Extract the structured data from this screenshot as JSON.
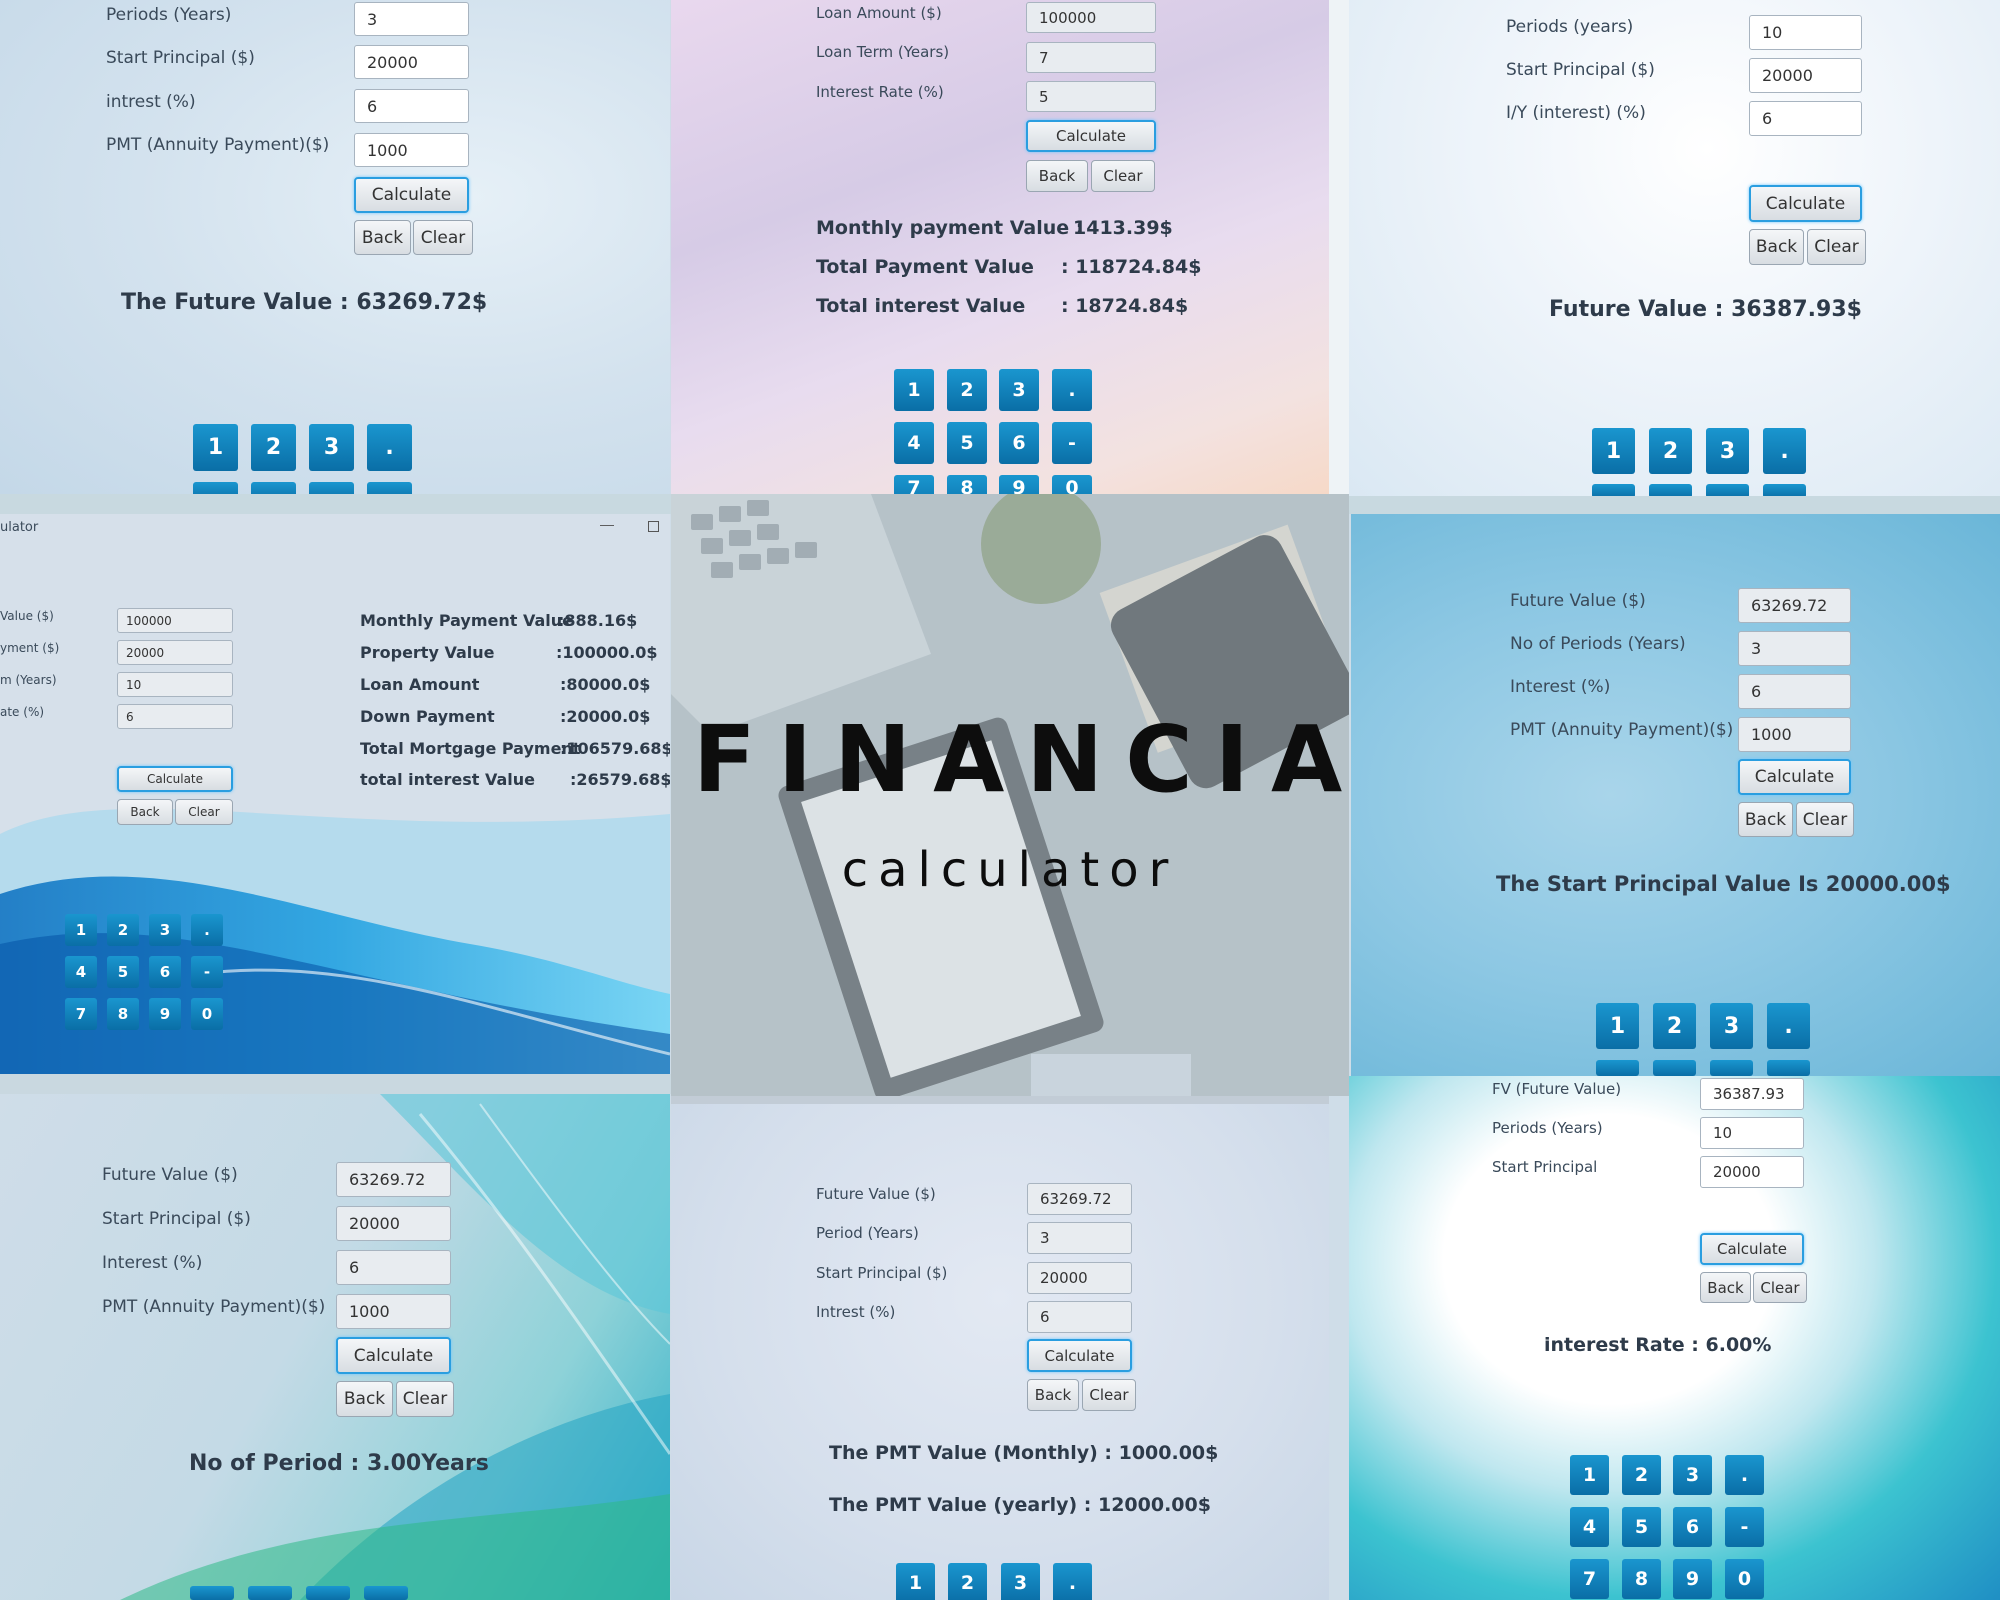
{
  "p1": {
    "labels": [
      "Periods (Years)",
      "Start Principal ($)",
      "intrest (%)",
      "PMT (Annuity Payment)($)"
    ],
    "values": [
      "3",
      "20000",
      "6",
      "1000"
    ],
    "calculate": "Calculate",
    "back": "Back",
    "clear": "Clear",
    "result": "The Future Value : 63269.72$",
    "keys": [
      "1",
      "2",
      "3",
      "."
    ]
  },
  "p2": {
    "labels": [
      "Loan Amount ($)",
      "Loan Term (Years)",
      "Interest Rate (%)"
    ],
    "values": [
      "100000",
      "7",
      "5"
    ],
    "calculate": "Calculate",
    "back": "Back",
    "clear": "Clear",
    "results": [
      {
        "label": "Monthly payment Value :",
        "value": "1413.39$"
      },
      {
        "label": "Total Payment Value",
        "value": ":  118724.84$"
      },
      {
        "label": "Total interest Value",
        "value": ": 18724.84$"
      }
    ],
    "keys_row1": [
      "1",
      "2",
      "3",
      "."
    ],
    "keys_row2": [
      "4",
      "5",
      "6",
      "-"
    ],
    "keys_row3": [
      "7",
      "8",
      "9",
      "0"
    ]
  },
  "p3": {
    "labels": [
      "Periods (years)",
      "Start Principal ($)",
      "I/Y (interest) (%)"
    ],
    "values": [
      "10",
      "20000",
      "6"
    ],
    "calculate": "Calculate",
    "back": "Back",
    "clear": "Clear",
    "result": "Future Value : 36387.93$",
    "keys": [
      "1",
      "2",
      "3",
      "."
    ]
  },
  "p4": {
    "title": "ulator",
    "labels": [
      "Value ($)",
      "yment ($)",
      "m (Years)",
      "ate (%)"
    ],
    "values": [
      "100000",
      "20000",
      "10",
      "6"
    ],
    "calculate": "Calculate",
    "back": "Back",
    "clear": "Clear",
    "results": [
      {
        "label": "Monthly Payment Value",
        "value": ":888.16$"
      },
      {
        "label": "Property Value",
        "value": ":100000.0$"
      },
      {
        "label": "Loan Amount",
        "value": ":80000.0$"
      },
      {
        "label": "Down Payment",
        "value": ":20000.0$"
      },
      {
        "label": "Total Mortgage Payment",
        "value": ":106579.68$"
      },
      {
        "label": "total interest Value",
        "value": ":26579.68$"
      }
    ],
    "keys_row1": [
      "1",
      "2",
      "3",
      "."
    ],
    "keys_row2": [
      "4",
      "5",
      "6",
      "-"
    ],
    "keys_row3": [
      "7",
      "8",
      "9",
      "0"
    ]
  },
  "center": {
    "title": "FINANCIAL",
    "subtitle": "calculator"
  },
  "p6": {
    "labels": [
      "Future Value ($)",
      "No of Periods (Years)",
      "Interest (%)",
      "PMT (Annuity Payment)($)"
    ],
    "values": [
      "63269.72",
      "3",
      "6",
      "1000"
    ],
    "calculate": "Calculate",
    "back": "Back",
    "clear": "Clear",
    "result": "The Start Principal Value Is 20000.00$",
    "keys": [
      "1",
      "2",
      "3",
      "."
    ]
  },
  "p7": {
    "labels": [
      "Future Value ($)",
      "Start Principal ($)",
      "Interest (%)",
      "PMT (Annuity Payment)($)"
    ],
    "values": [
      "63269.72",
      "20000",
      "6",
      "1000"
    ],
    "calculate": "Calculate",
    "back": "Back",
    "clear": "Clear",
    "result": "No of Period : 3.00Years"
  },
  "p8": {
    "labels": [
      "Future Value ($)",
      "Period (Years)",
      "Start Principal ($)",
      "Intrest (%)"
    ],
    "values": [
      "63269.72",
      "3",
      "20000",
      "6"
    ],
    "calculate": "Calculate",
    "back": "Back",
    "clear": "Clear",
    "results": [
      "The PMT Value (Monthly) : 1000.00$",
      "The PMT Value (yearly) : 12000.00$"
    ],
    "keys": [
      "1",
      "2",
      "3",
      "."
    ]
  },
  "p9": {
    "labels": [
      "FV (Future Value)",
      "Periods (Years)",
      "Start Principal"
    ],
    "values": [
      "36387.93",
      "10",
      "20000"
    ],
    "calculate": "Calculate",
    "back": "Back",
    "clear": "Clear",
    "result": "interest Rate : 6.00%",
    "keys_row1": [
      "1",
      "2",
      "3",
      "."
    ],
    "keys_row2": [
      "4",
      "5",
      "6",
      "-"
    ],
    "keys_row3": [
      "7",
      "8",
      "9",
      "0"
    ]
  },
  "colors": {
    "key_blue": "#0f82bd",
    "accent": "#2a9ee0"
  }
}
